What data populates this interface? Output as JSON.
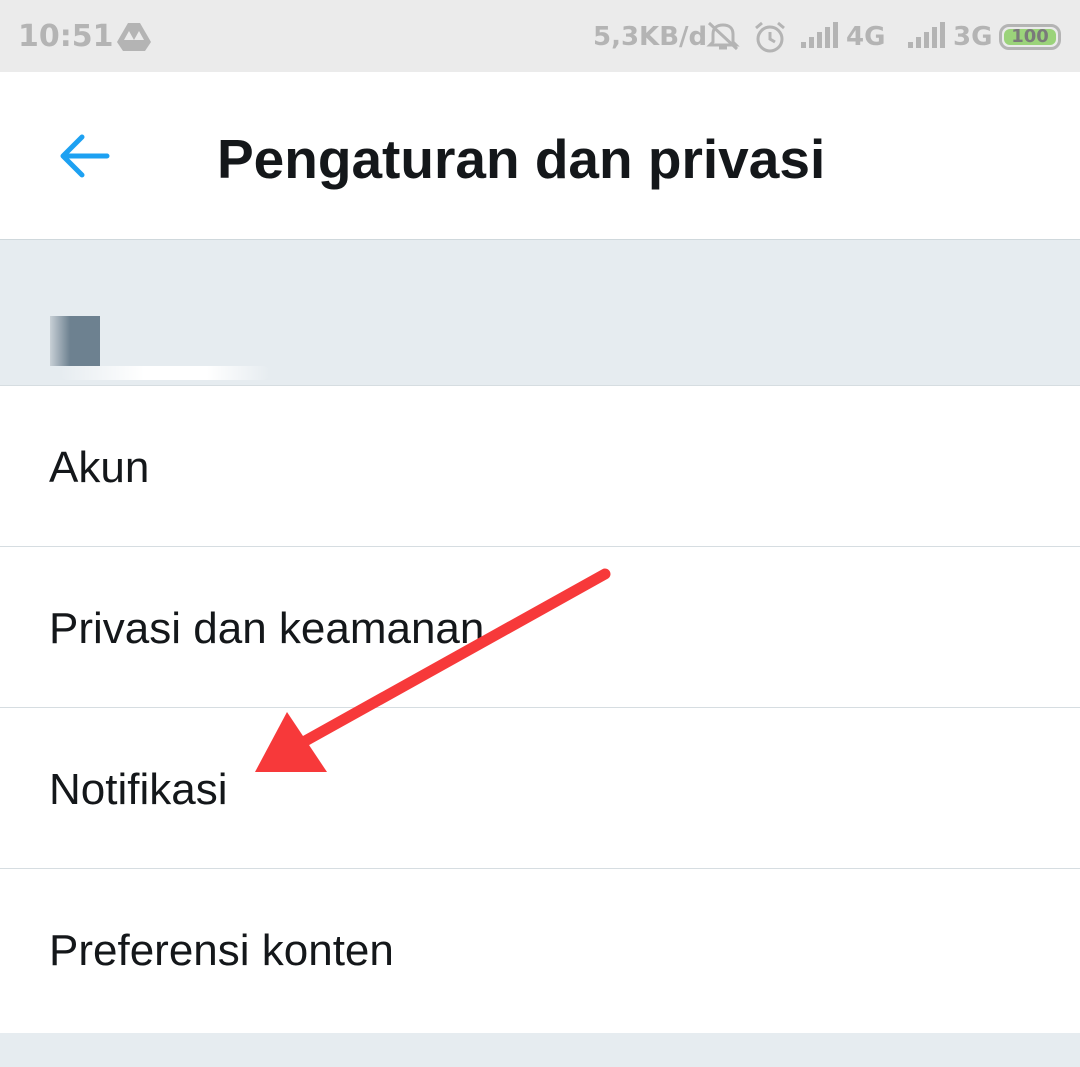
{
  "status_bar": {
    "time": "10:51",
    "net_speed": "5,3KB/d",
    "network_1": "4G",
    "network_2": "3G",
    "battery": "100",
    "icons": [
      "drive-icon",
      "mute-icon",
      "alarm-icon",
      "signal-icon",
      "signal-icon"
    ]
  },
  "header": {
    "back_icon": "arrow-left-icon",
    "title": "Pengaturan dan privasi",
    "accent_color": "#1da1f2"
  },
  "menu": {
    "items": [
      {
        "label": "Akun"
      },
      {
        "label": "Privasi dan keamanan"
      },
      {
        "label": "Notifikasi"
      },
      {
        "label": "Preferensi konten"
      }
    ]
  },
  "annotation": {
    "type": "arrow",
    "color": "#f7393a",
    "points_to": "Notifikasi"
  }
}
